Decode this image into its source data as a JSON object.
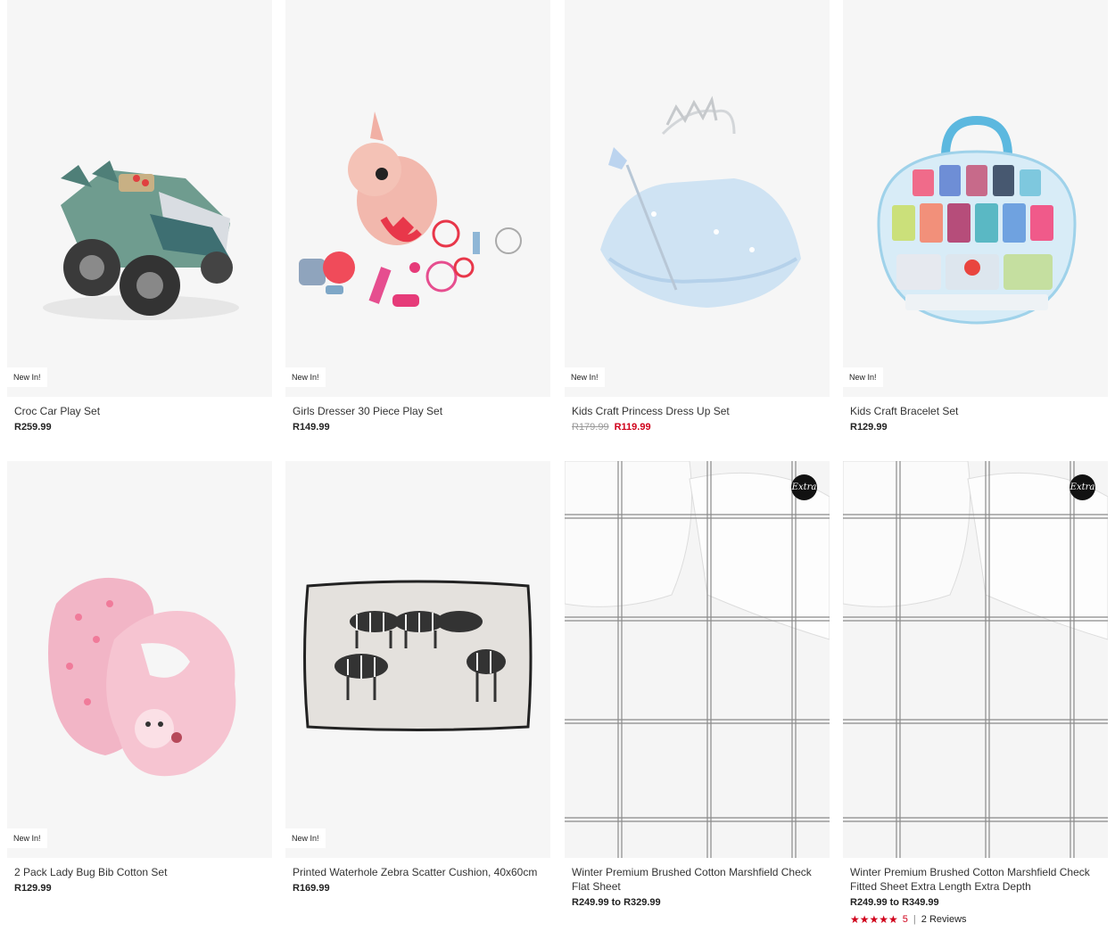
{
  "colors": {
    "sale": "#d0021b",
    "image_bg": "#f6f6f6"
  },
  "products": [
    {
      "name": "Croc Car Play Set",
      "price": "R259.99",
      "badge": "New In!",
      "image": "croc-car-toy"
    },
    {
      "name": "Girls Dresser 30 Piece Play Set",
      "price": "R149.99",
      "badge": "New In!",
      "image": "unicorn-dresser-toy"
    },
    {
      "name": "Kids Craft Princess Dress Up Set",
      "was_price": "R179.99",
      "price": "R119.99",
      "badge": "New In!",
      "image": "princess-tutu-wand-tiara"
    },
    {
      "name": "Kids Craft Bracelet Set",
      "price": "R129.99",
      "badge": "New In!",
      "image": "bead-case"
    },
    {
      "name": "2 Pack Lady Bug Bib Cotton Set",
      "price": "R129.99",
      "badge": "New In!",
      "image": "pink-bibs"
    },
    {
      "name": "Printed Waterhole Zebra Scatter Cushion, 40x60cm",
      "price": "R169.99",
      "badge": "New In!",
      "image": "zebra-cushion"
    },
    {
      "name": "Winter Premium Brushed Cotton Marshfield Check Flat Sheet",
      "price": "R249.99 to R329.99",
      "extra_badge": "Extra",
      "image": "check-bedding"
    },
    {
      "name": "Winter Premium Brushed Cotton Marshfield Check Fitted Sheet Extra Length Extra Depth",
      "price": "R249.99 to R349.99",
      "extra_badge": "Extra",
      "image": "check-bedding",
      "rating": {
        "stars": "★★★★★",
        "score": "5",
        "separator": "|",
        "reviews": "2 Reviews"
      }
    }
  ]
}
